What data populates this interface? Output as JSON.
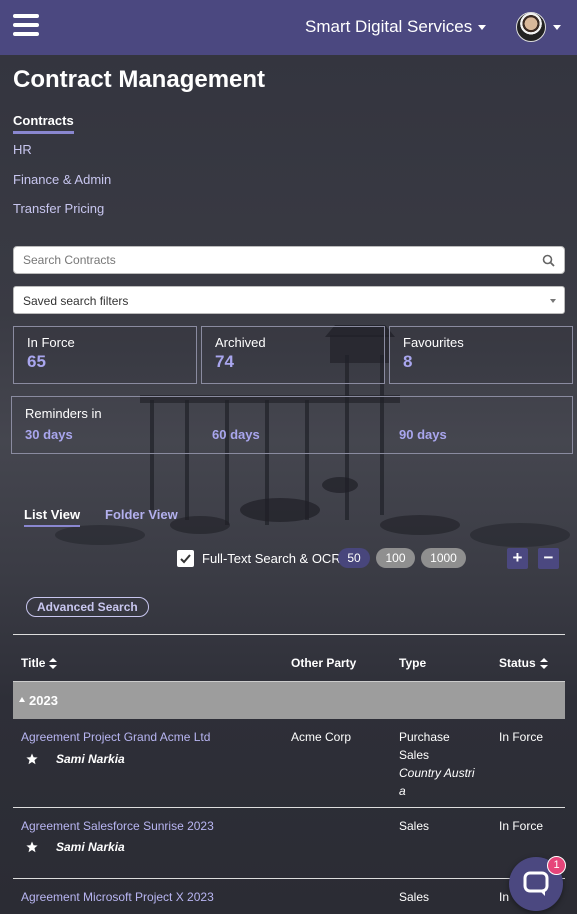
{
  "header": {
    "org_name": "Smart Digital Services",
    "icons": [
      "hamburger-menu-icon",
      "user-avatar"
    ]
  },
  "page": {
    "title": "Contract Management"
  },
  "nav": {
    "items": [
      {
        "label": "Contracts",
        "active": true
      },
      {
        "label": "HR"
      },
      {
        "label": "Finance & Admin"
      },
      {
        "label": "Transfer Pricing"
      }
    ]
  },
  "search": {
    "placeholder": "Search Contracts"
  },
  "saved_filters": {
    "value": "Saved search filters"
  },
  "stats": [
    {
      "label": "In Force",
      "value": "65"
    },
    {
      "label": "Archived",
      "value": "74"
    },
    {
      "label": "Favourites",
      "value": "8"
    }
  ],
  "reminders": {
    "label": "Reminders in",
    "options": [
      "30 days",
      "60 days",
      "90 days"
    ]
  },
  "view_tabs": {
    "list": "List View",
    "folder": "Folder View"
  },
  "options": {
    "fulltext_label": "Full-Text Search & OCR",
    "fulltext_checked": true,
    "page_sizes": [
      "50",
      "100",
      "1000"
    ],
    "selected_page_size": "50",
    "plus": "+",
    "minus": "−",
    "advanced_search": "Advanced Search"
  },
  "table": {
    "columns": [
      "Title",
      "Other Party",
      "Type",
      "Status"
    ],
    "group": "2023",
    "rows": [
      {
        "title": "Agreement Project Grand Acme Ltd",
        "owner": "Sami Narkia",
        "other_party": "Acme Corp",
        "type_lines": [
          "Purchase",
          "Sales"
        ],
        "type_extra": [
          "Country Austri",
          "a"
        ],
        "status": "In Force"
      },
      {
        "title": "Agreement Salesforce Sunrise 2023",
        "owner": "Sami Narkia",
        "other_party": "",
        "type_lines": [
          "Sales"
        ],
        "status": "In Force"
      },
      {
        "title": "Agreement Microsoft Project X 2023",
        "other_party": "",
        "type_lines": [
          "Sales"
        ],
        "status": "In"
      }
    ]
  },
  "chat": {
    "badge": "1"
  },
  "colors": {
    "header_bg": "#4b4880",
    "accent": "#a9a6ee",
    "link": "#b8b5f2",
    "badge": "#e6457a"
  }
}
